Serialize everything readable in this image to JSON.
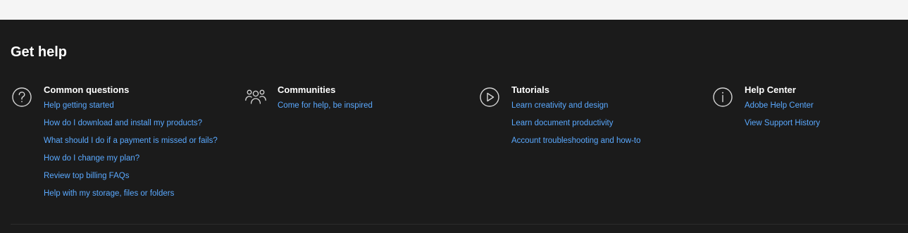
{
  "footer": {
    "title": "Get help",
    "columns": [
      {
        "icon": "question-icon",
        "heading": "Common questions",
        "links": [
          "Help getting started",
          "How do I download and install my products?",
          "What should I do if a payment is missed or fails?",
          "How do I change my plan?",
          "Review top billing FAQs",
          "Help with my storage, files or folders"
        ]
      },
      {
        "icon": "community-icon",
        "heading": "Communities",
        "links": [
          "Come for help, be inspired"
        ]
      },
      {
        "icon": "play-icon",
        "heading": "Tutorials",
        "links": [
          "Learn creativity and design",
          "Learn document productivity",
          "Account troubleshooting and how-to"
        ]
      },
      {
        "icon": "info-icon",
        "heading": "Help Center",
        "links": [
          "Adobe Help Center",
          "View Support History"
        ]
      }
    ]
  },
  "colors": {
    "background": "#1b1b1b",
    "top_strip": "#f5f5f5",
    "heading": "#ffffff",
    "link": "#5aa9ff",
    "icon": "#d5d5d5"
  }
}
